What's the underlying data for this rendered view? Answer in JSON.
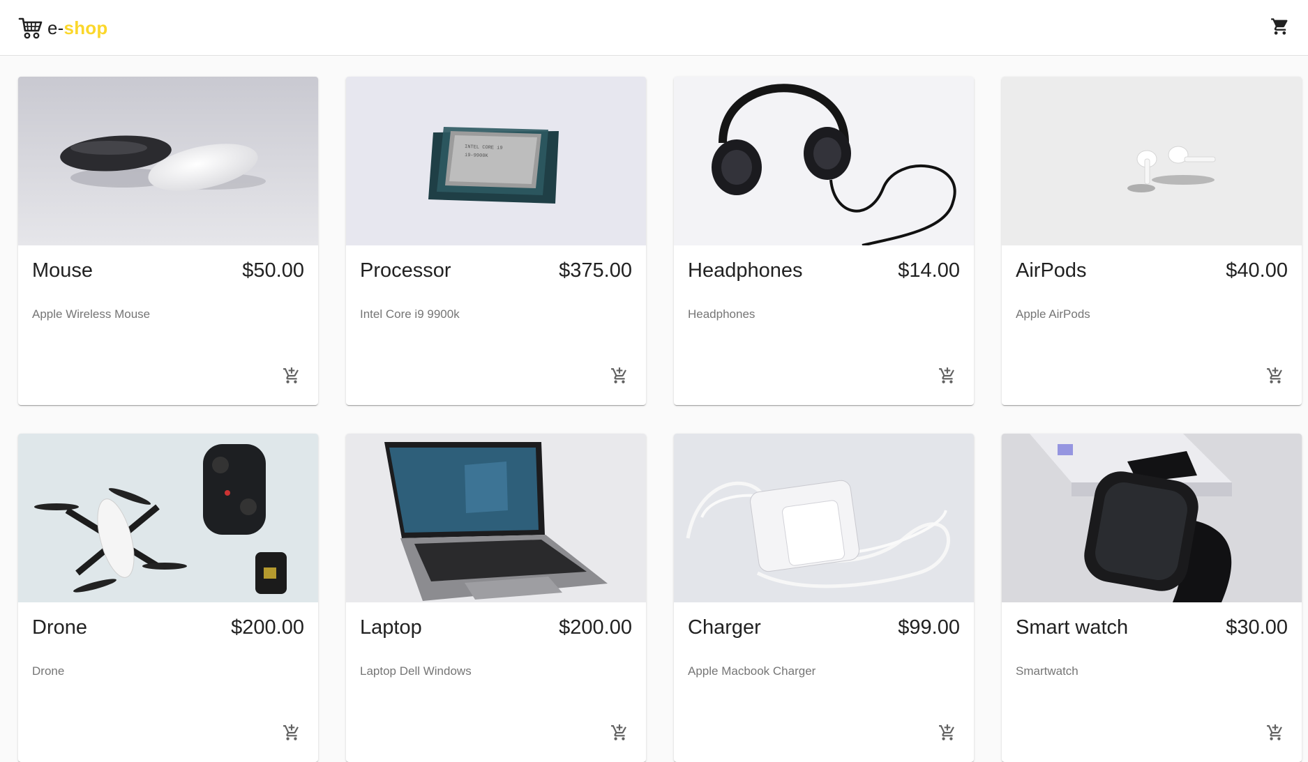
{
  "header": {
    "brand_prefix": "e-",
    "brand_accent": "shop",
    "logo_icon": "shopping-cart-logo-icon",
    "cart_icon": "shopping-cart-icon",
    "accent_color": "#fbd72b"
  },
  "products": [
    {
      "name": "Mouse",
      "price": "$50.00",
      "description": "Apple Wireless Mouse"
    },
    {
      "name": "Processor",
      "price": "$375.00",
      "description": "Intel Core i9 9900k"
    },
    {
      "name": "Headphones",
      "price": "$14.00",
      "description": "Headphones"
    },
    {
      "name": "AirPods",
      "price": "$40.00",
      "description": "Apple AirPods"
    },
    {
      "name": "Drone",
      "price": "$200.00",
      "description": "Drone"
    },
    {
      "name": "Laptop",
      "price": "$200.00",
      "description": "Laptop Dell Windows"
    },
    {
      "name": "Charger",
      "price": "$99.00",
      "description": "Apple Macbook Charger"
    },
    {
      "name": "Smart watch",
      "price": "$30.00",
      "description": "Smartwatch"
    }
  ],
  "card_action_icon": "add-shopping-cart-icon"
}
